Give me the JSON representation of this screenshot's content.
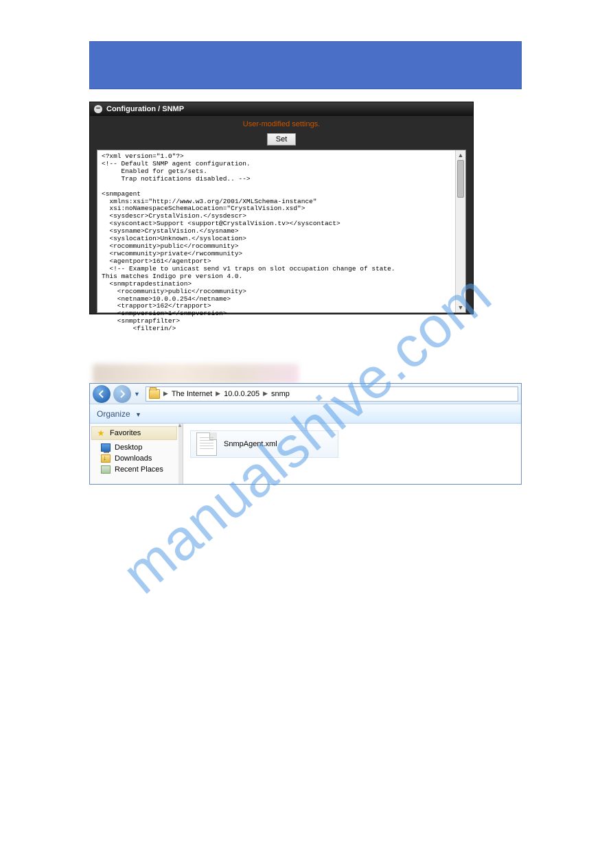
{
  "watermark": "manualshive.com",
  "config_panel": {
    "title": "Configuration / SNMP",
    "message": "User-modified settings.",
    "set_button": "Set",
    "xml_content": "<?xml version=\"1.0\"?>\n<!-- Default SNMP agent configuration.\n     Enabled for gets/sets.\n     Trap notifications disabled.. -->\n\n<snmpagent\n  xmlns:xsi=\"http://www.w3.org/2001/XMLSchema-instance\"\n  xsi:noNamespaceSchemaLocation=\"CrystalVision.xsd\">\n  <sysdescr>CrystalVision.</sysdescr>\n  <syscontact>Support <support@CrystalVision.tv></syscontact>\n  <sysname>CrystalVision.</sysname>\n  <syslocation>Unknown.</syslocation>\n  <rocommunity>public</rocommunity>\n  <rwcommunity>private</rwcommunity>\n  <agentport>161</agentport>\n  <!-- Example to unicast send v1 traps on slot occupation change of state.\nThis matches Indigo pre version 4.0.\n  <snmptrapdestination>\n    <rocommunity>public</rocommunity>\n    <netname>10.0.0.254</netname>\n    <trapport>162</trapport>\n    <snmpversion>1</snmpversion>\n    <snmptrapfilter>\n        <filterin/>"
  },
  "explorer": {
    "breadcrumb": {
      "root": "The Internet",
      "ip": "10.0.0.205",
      "folder": "snmp"
    },
    "organize_label": "Organize",
    "sidebar": {
      "favorites": "Favorites",
      "desktop": "Desktop",
      "downloads": "Downloads",
      "recent_places": "Recent Places"
    },
    "file": {
      "name": "SnmpAgent.xml"
    }
  }
}
